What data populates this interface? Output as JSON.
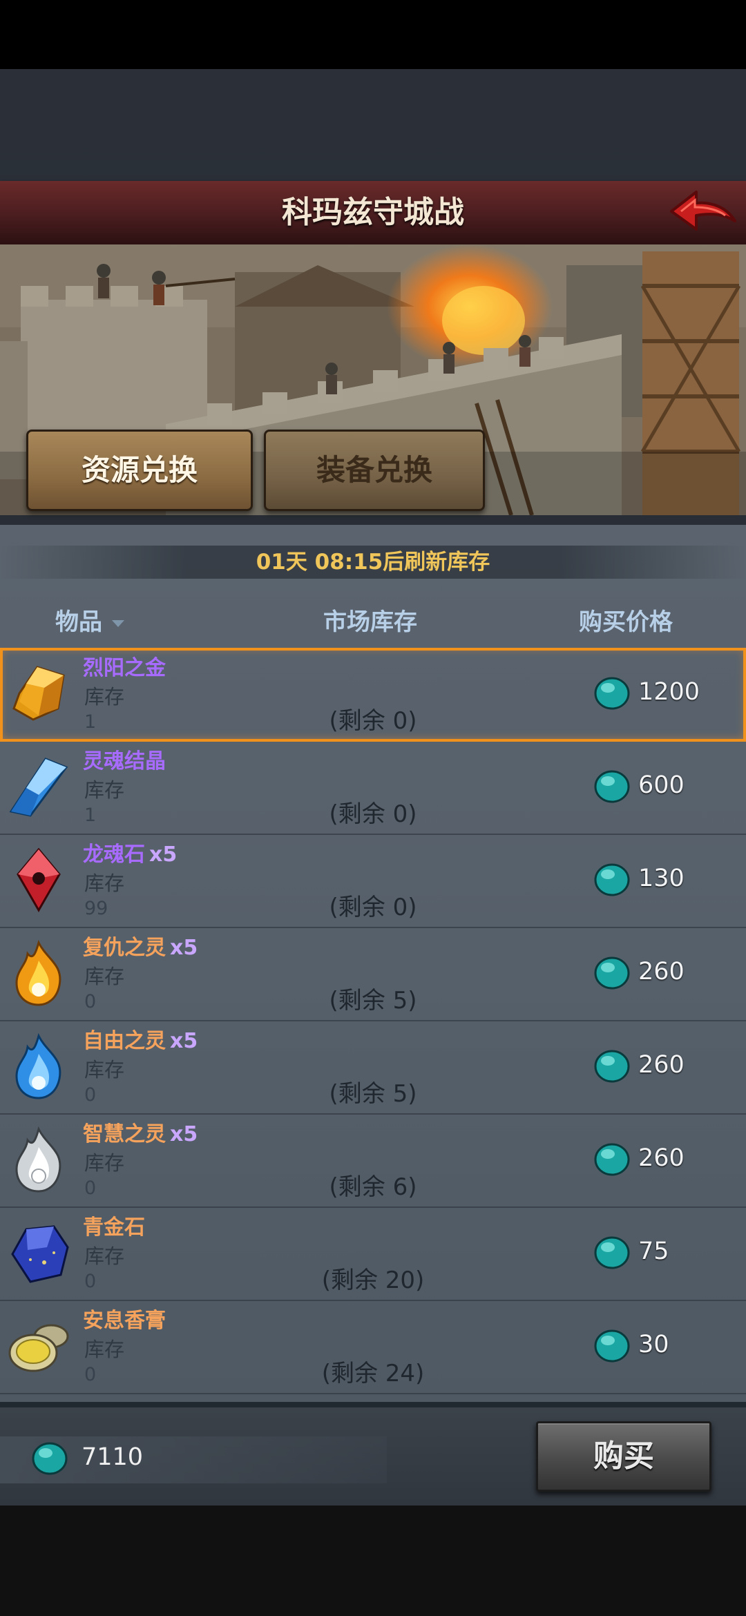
{
  "header": {
    "title": "科玛兹守城战"
  },
  "tabs": [
    {
      "label": "资源兑换",
      "active": true
    },
    {
      "label": "装备兑换",
      "active": false
    }
  ],
  "refresh_text": "01天 08:15后刷新库存",
  "columns": {
    "item": "物品",
    "stock": "市场库存",
    "price": "购买价格"
  },
  "items": [
    {
      "name": "烈阳之金",
      "qty": "",
      "name_color": "#a86bff",
      "icon": "amber-crystal-icon",
      "stock_label": "库存",
      "stock": "1",
      "remaining": "(剩余 0)",
      "price": "1200",
      "selected": true
    },
    {
      "name": "灵魂结晶",
      "qty": "",
      "name_color": "#a86bff",
      "icon": "blue-crystal-icon",
      "stock_label": "库存",
      "stock": "1",
      "remaining": "(剩余 0)",
      "price": "600"
    },
    {
      "name": "龙魂石",
      "qty": "x5",
      "name_color": "#a86bff",
      "icon": "red-dragon-gem-icon",
      "stock_label": "库存",
      "stock": "99",
      "remaining": "(剩余 0)",
      "price": "130"
    },
    {
      "name": "复仇之灵",
      "qty": "x5",
      "name_color": "#f4a25c",
      "icon": "orange-flame-icon",
      "stock_label": "库存",
      "stock": "0",
      "remaining": "(剩余 5)",
      "price": "260"
    },
    {
      "name": "自由之灵",
      "qty": "x5",
      "name_color": "#f4a25c",
      "icon": "blue-flame-icon",
      "stock_label": "库存",
      "stock": "0",
      "remaining": "(剩余 5)",
      "price": "260"
    },
    {
      "name": "智慧之灵",
      "qty": "x5",
      "name_color": "#f4a25c",
      "icon": "white-flame-icon",
      "stock_label": "库存",
      "stock": "0",
      "remaining": "(剩余 6)",
      "price": "260"
    },
    {
      "name": "青金石",
      "qty": "",
      "name_color": "#f4a25c",
      "icon": "lapis-stone-icon",
      "stock_label": "库存",
      "stock": "0",
      "remaining": "(剩余 20)",
      "price": "75"
    },
    {
      "name": "安息香膏",
      "qty": "",
      "name_color": "#f4a25c",
      "icon": "ointment-tin-icon",
      "stock_label": "库存",
      "stock": "0",
      "remaining": "(剩余 24)",
      "price": "30"
    }
  ],
  "balance": "7110",
  "buy_label": "购买",
  "currency_icon": "turquoise-gem-icon",
  "colors": {
    "refresh": "#f0c65a",
    "header_text": "#b8cfe8",
    "selected_outline": "#f0921c"
  }
}
